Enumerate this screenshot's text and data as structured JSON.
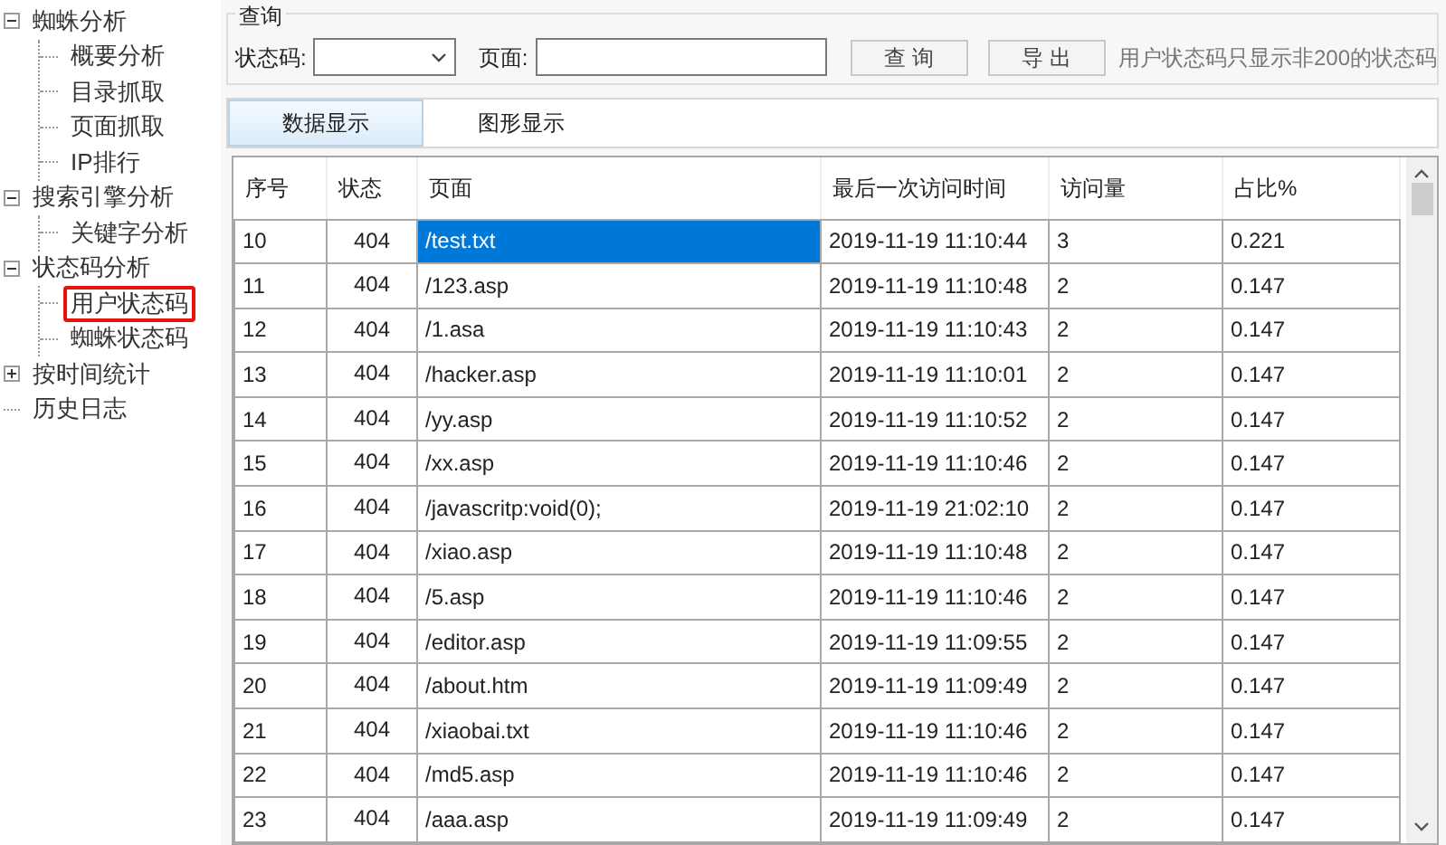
{
  "tree": [
    {
      "label": "蜘蛛分析",
      "expanded": true,
      "selected": false,
      "children": [
        {
          "label": "概要分析",
          "selected": false
        },
        {
          "label": "目录抓取",
          "selected": false
        },
        {
          "label": "页面抓取",
          "selected": false
        },
        {
          "label": "IP排行",
          "selected": false
        }
      ]
    },
    {
      "label": "搜索引擎分析",
      "expanded": true,
      "selected": false,
      "children": [
        {
          "label": "关键字分析",
          "selected": false
        }
      ]
    },
    {
      "label": "状态码分析",
      "expanded": true,
      "selected": false,
      "children": [
        {
          "label": "用户状态码",
          "selected": true
        },
        {
          "label": "蜘蛛状态码",
          "selected": false
        }
      ]
    },
    {
      "label": "按时间统计",
      "expanded": false,
      "selected": false
    },
    {
      "label": "历史日志",
      "selected": false
    }
  ],
  "query": {
    "legend": "查询",
    "status_label": "状态码:",
    "page_label": "页面:",
    "buttons": [
      "查 询",
      "导 出"
    ],
    "note": "用户状态码只显示非200的状态码"
  },
  "tabs": [
    {
      "label": "数据显示",
      "selected": true
    },
    {
      "label": "图形显示",
      "selected": false
    }
  ],
  "table": {
    "columns": [
      "序号",
      "状态",
      "页面",
      "最后一次访问时间",
      "访问量",
      "占比%"
    ],
    "rows": [
      {
        "cells": [
          "10",
          "404",
          "/test.txt",
          "2019-11-19 11:10:44",
          "3",
          "0.221"
        ],
        "selected": true
      },
      {
        "cells": [
          "11",
          "404",
          "/123.asp",
          "2019-11-19 11:10:48",
          "2",
          "0.147"
        ],
        "selected": false
      },
      {
        "cells": [
          "12",
          "404",
          "/1.asa",
          "2019-11-19 11:10:43",
          "2",
          "0.147"
        ],
        "selected": false
      },
      {
        "cells": [
          "13",
          "404",
          "/hacker.asp",
          "2019-11-19 11:10:01",
          "2",
          "0.147"
        ],
        "selected": false
      },
      {
        "cells": [
          "14",
          "404",
          "/yy.asp",
          "2019-11-19 11:10:52",
          "2",
          "0.147"
        ],
        "selected": false
      },
      {
        "cells": [
          "15",
          "404",
          "/xx.asp",
          "2019-11-19 11:10:46",
          "2",
          "0.147"
        ],
        "selected": false
      },
      {
        "cells": [
          "16",
          "404",
          "/javascritp:void(0);",
          "2019-11-19 21:02:10",
          "2",
          "0.147"
        ],
        "selected": false
      },
      {
        "cells": [
          "17",
          "404",
          "/xiao.asp",
          "2019-11-19 11:10:48",
          "2",
          "0.147"
        ],
        "selected": false
      },
      {
        "cells": [
          "18",
          "404",
          "/5.asp",
          "2019-11-19 11:10:46",
          "2",
          "0.147"
        ],
        "selected": false
      },
      {
        "cells": [
          "19",
          "404",
          "/editor.asp",
          "2019-11-19 11:09:55",
          "2",
          "0.147"
        ],
        "selected": false
      },
      {
        "cells": [
          "20",
          "404",
          "/about.htm",
          "2019-11-19 11:09:49",
          "2",
          "0.147"
        ],
        "selected": false
      },
      {
        "cells": [
          "21",
          "404",
          "/xiaobai.txt",
          "2019-11-19 11:10:46",
          "2",
          "0.147"
        ],
        "selected": false
      },
      {
        "cells": [
          "22",
          "404",
          "/md5.asp",
          "2019-11-19 11:10:46",
          "2",
          "0.147"
        ],
        "selected": false
      },
      {
        "cells": [
          "23",
          "404",
          "/aaa.asp",
          "2019-11-19 11:09:49",
          "2",
          "0.147"
        ],
        "selected": false
      }
    ]
  }
}
